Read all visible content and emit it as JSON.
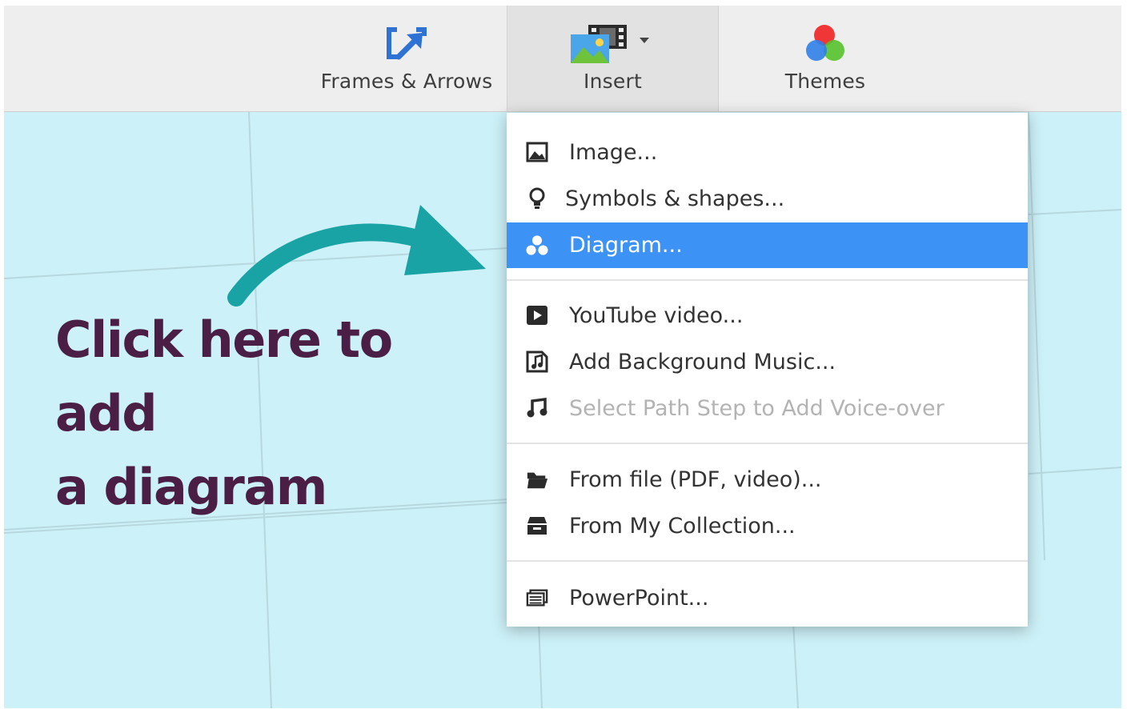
{
  "toolbar": {
    "frames_label": "Frames & Arrows",
    "insert_label": "Insert",
    "themes_label": "Themes"
  },
  "canvas": {
    "callout_line1": "Click here to add",
    "callout_line2": "a diagram",
    "callout_color": "#4a1e45",
    "arrow_color": "#1aa3a5",
    "background_color": "#cdf1f8"
  },
  "insert_menu": {
    "items": [
      {
        "label": "Image...",
        "icon": "image-icon"
      },
      {
        "label": "Symbols & shapes...",
        "icon": "lightbulb-icon"
      },
      {
        "label": "Diagram...",
        "icon": "diagram-icon",
        "state": "highlighted"
      },
      {
        "label": "YouTube video...",
        "icon": "play-icon"
      },
      {
        "label": "Add Background Music...",
        "icon": "music-file-icon"
      },
      {
        "label": "Select Path Step to Add Voice-over",
        "icon": "music-note-icon",
        "state": "disabled"
      },
      {
        "label": "From file (PDF, video)...",
        "icon": "folder-icon"
      },
      {
        "label": "From My Collection...",
        "icon": "archive-icon"
      },
      {
        "label": "PowerPoint...",
        "icon": "slides-icon"
      }
    ],
    "highlight_color": "#3d92f5"
  }
}
